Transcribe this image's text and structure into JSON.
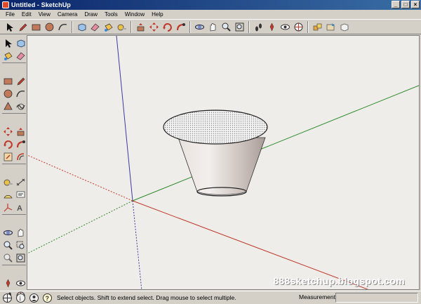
{
  "window": {
    "title": "Untitled - SketchUp",
    "controls": [
      "_",
      "□",
      "×"
    ]
  },
  "menu": [
    "File",
    "Edit",
    "View",
    "Camera",
    "Draw",
    "Tools",
    "Window",
    "Help"
  ],
  "toolbar": {
    "tools": [
      "select-arrow",
      "pencil",
      "rectangle",
      "circle",
      "arc",
      "sep",
      "make-component",
      "eraser",
      "paint-bucket",
      "tape-measure",
      "sep",
      "push-pull",
      "move",
      "rotate",
      "follow-me",
      "sep",
      "orbit",
      "pan",
      "zoom",
      "zoom-extents",
      "sep",
      "walk",
      "position-camera",
      "look-around",
      "section-plane",
      "sep",
      "get-models",
      "share-model",
      "share-component"
    ]
  },
  "left_toolbar": {
    "tools": [
      [
        "select-arrow",
        "make-component"
      ],
      [
        "paint-bucket",
        "eraser"
      ],
      "sep",
      [
        "rectangle",
        "pencil"
      ],
      [
        "circle",
        "arc"
      ],
      [
        "polygon",
        "freehand"
      ],
      "sep",
      [
        "move",
        "push-pull"
      ],
      [
        "rotate",
        "follow-me"
      ],
      [
        "scale",
        "offset"
      ],
      "sep",
      [
        "tape-measure",
        "dimension"
      ],
      [
        "protractor",
        "text"
      ],
      [
        "axes",
        "3d-text"
      ],
      "sep",
      [
        "orbit",
        "pan"
      ],
      [
        "zoom",
        "zoom-window"
      ],
      [
        "previous-view",
        "zoom-extents"
      ],
      "sep",
      [
        "position-camera",
        "look-around"
      ],
      [
        "walk",
        "section-plane"
      ]
    ]
  },
  "status": {
    "text": "Select objects. Shift to extend select. Drag mouse to select multiple.",
    "measurements_label": "Measurements",
    "measurements_value": ""
  },
  "watermark": "888sketchup.blogspot.com",
  "colors": {
    "titlebar": "#0a246a",
    "viewport": "#efede9",
    "axis_red": "#c0392b",
    "axis_green": "#2e8b2e",
    "axis_blue": "#3a3a9a"
  }
}
